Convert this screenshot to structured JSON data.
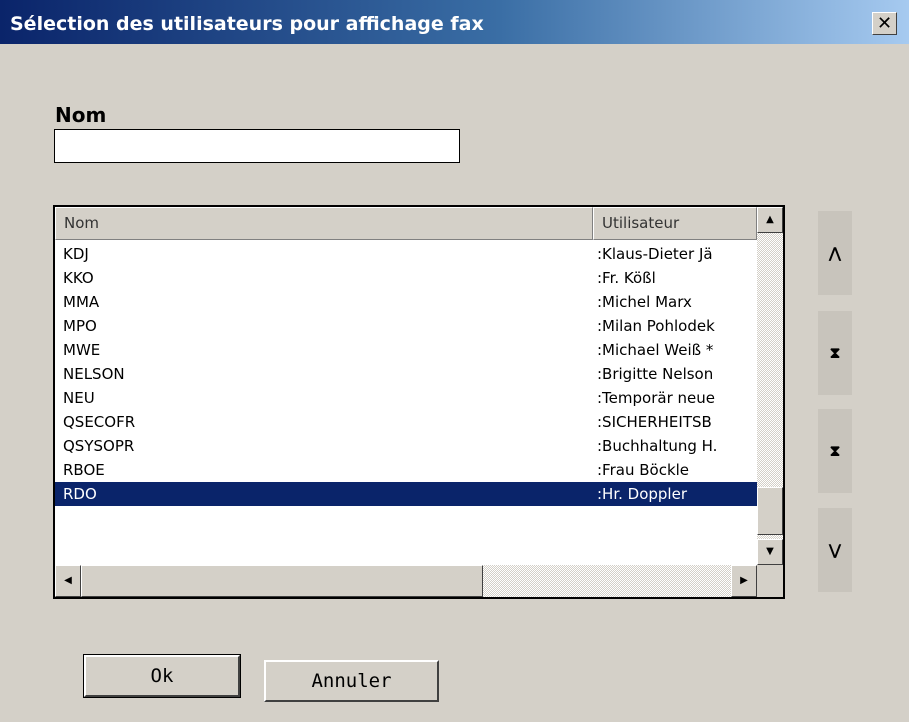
{
  "window": {
    "title": "Sélection des utilisateurs pour affichage fax",
    "close_glyph": "✕"
  },
  "form": {
    "name_label": "Nom",
    "name_value": ""
  },
  "list": {
    "columns": [
      "Nom",
      "Utilisateur"
    ],
    "rows": [
      {
        "nom": "KDJ",
        "utilisateur": ":Klaus-Dieter Jä"
      },
      {
        "nom": "KKO",
        "utilisateur": ":Fr. Kößl"
      },
      {
        "nom": "MMA",
        "utilisateur": ":Michel Marx"
      },
      {
        "nom": "MPO",
        "utilisateur": ":Milan Pohlodek"
      },
      {
        "nom": "MWE",
        "utilisateur": ":Michael Weiß *"
      },
      {
        "nom": "NELSON",
        "utilisateur": ":Brigitte Nelson"
      },
      {
        "nom": "NEU",
        "utilisateur": ":Temporär neue"
      },
      {
        "nom": "QSECOFR",
        "utilisateur": ":SICHERHEITSB"
      },
      {
        "nom": "QSYSOPR",
        "utilisateur": ":Buchhaltung H."
      },
      {
        "nom": "RBOE",
        "utilisateur": ":Frau Böckle"
      },
      {
        "nom": "RDO",
        "utilisateur": ":Hr. Doppler"
      }
    ],
    "selected_index": 10
  },
  "side_buttons": {
    "up": "⋀",
    "top": "⧗",
    "bottom": "⧗",
    "down": "⋁"
  },
  "buttons": {
    "ok": "Ok",
    "cancel": "Annuler"
  }
}
